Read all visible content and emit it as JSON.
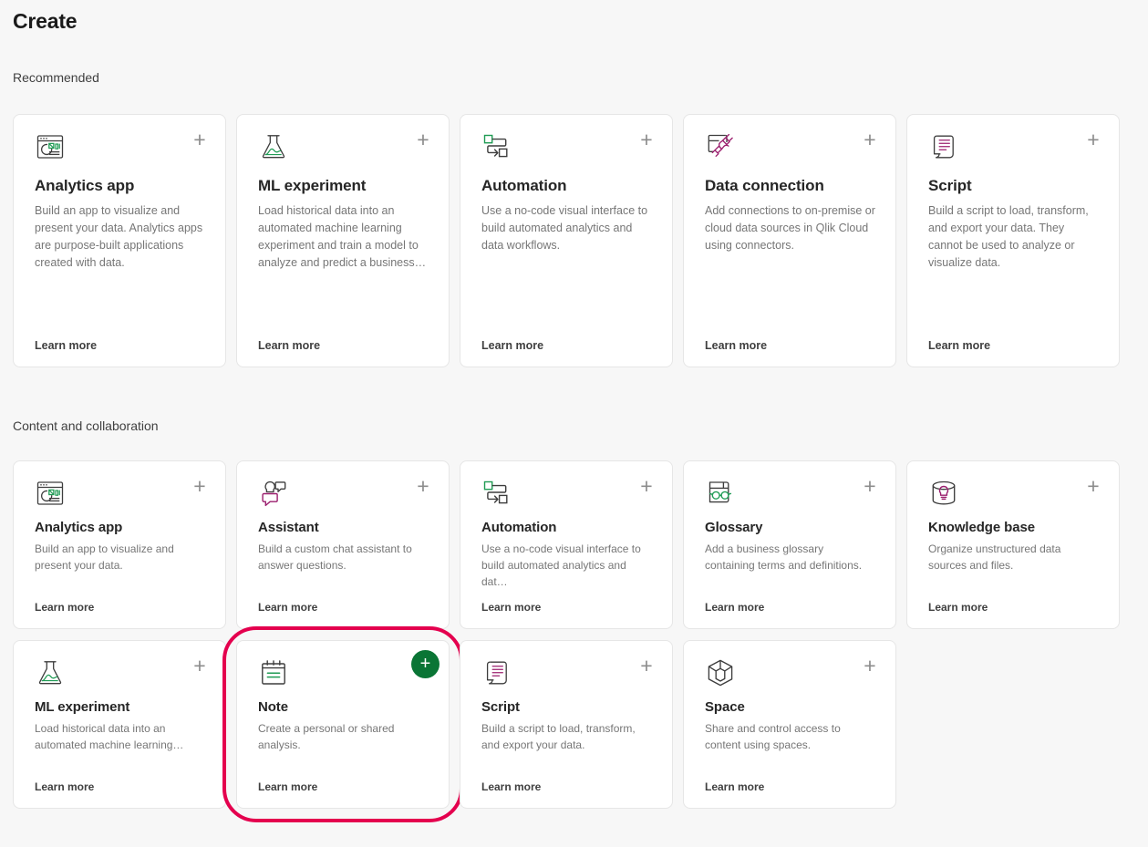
{
  "page": {
    "title": "Create",
    "background": "#f7f7f7",
    "accent_green": "#0a7535",
    "highlight_pink": "#e4004e"
  },
  "sections": [
    {
      "label": "Recommended",
      "size": "tall",
      "cards": [
        {
          "icon": "analytics-app-window-icon",
          "title": "Analytics app",
          "description": "Build an app to visualize and present your data. Analytics apps are purpose-built applications created with data.",
          "learn_more": "Learn more",
          "add_label": "+",
          "add_style": "plain"
        },
        {
          "icon": "ml-experiment-flask-icon",
          "title": "ML experiment",
          "description": "Load historical data into an automated machine learning experiment and train a model to analyze and predict a business…",
          "learn_more": "Learn more",
          "add_label": "+",
          "add_style": "plain"
        },
        {
          "icon": "automation-flow-icon",
          "title": "Automation",
          "description": "Use a no-code visual interface to build automated analytics and data workflows.",
          "learn_more": "Learn more",
          "add_label": "+",
          "add_style": "plain"
        },
        {
          "icon": "data-connection-plug-icon",
          "title": "Data connection",
          "description": "Add connections to on-premise or cloud data sources in Qlik Cloud using connectors.",
          "learn_more": "Learn more",
          "add_label": "+",
          "add_style": "plain"
        },
        {
          "icon": "script-scroll-icon",
          "title": "Script",
          "description": "Build a script to load, transform, and export your data. They cannot be used to analyze or visualize data.",
          "learn_more": "Learn more",
          "add_label": "+",
          "add_style": "plain"
        }
      ]
    },
    {
      "label": "Content and collaboration",
      "size": "short",
      "cards": [
        {
          "icon": "analytics-app-window-icon",
          "title": "Analytics app",
          "description": "Build an app to visualize and present your data.",
          "learn_more": "Learn more",
          "add_label": "+",
          "add_style": "plain"
        },
        {
          "icon": "assistant-chat-icon",
          "title": "Assistant",
          "description": "Build a custom chat assistant to answer questions.",
          "learn_more": "Learn more",
          "add_label": "+",
          "add_style": "plain"
        },
        {
          "icon": "automation-flow-icon",
          "title": "Automation",
          "description": "Use a no-code visual interface to build automated analytics and dat…",
          "learn_more": "Learn more",
          "add_label": "+",
          "add_style": "plain"
        },
        {
          "icon": "glossary-book-icon",
          "title": "Glossary",
          "description": "Add a business glossary containing terms and definitions.",
          "learn_more": "Learn more",
          "add_label": "+",
          "add_style": "plain"
        },
        {
          "icon": "knowledge-base-database-icon",
          "title": "Knowledge base",
          "description": "Organize unstructured data sources and files.",
          "learn_more": "Learn more",
          "add_label": "+",
          "add_style": "plain"
        },
        {
          "icon": "ml-experiment-flask-icon",
          "title": "ML experiment",
          "description": "Load historical data into an automated machine learning…",
          "learn_more": "Learn more",
          "add_label": "+",
          "add_style": "plain"
        },
        {
          "icon": "note-icon",
          "title": "Note",
          "description": "Create a personal or shared analysis.",
          "learn_more": "Learn more",
          "add_label": "+",
          "add_style": "green",
          "highlighted": true
        },
        {
          "icon": "script-scroll-icon",
          "title": "Script",
          "description": "Build a script to load, transform, and export your data.",
          "learn_more": "Learn more",
          "add_label": "+",
          "add_style": "plain"
        },
        {
          "icon": "space-cube-icon",
          "title": "Space",
          "description": "Share and control access to content using spaces.",
          "learn_more": "Learn more",
          "add_label": "+",
          "add_style": "plain"
        }
      ]
    }
  ]
}
